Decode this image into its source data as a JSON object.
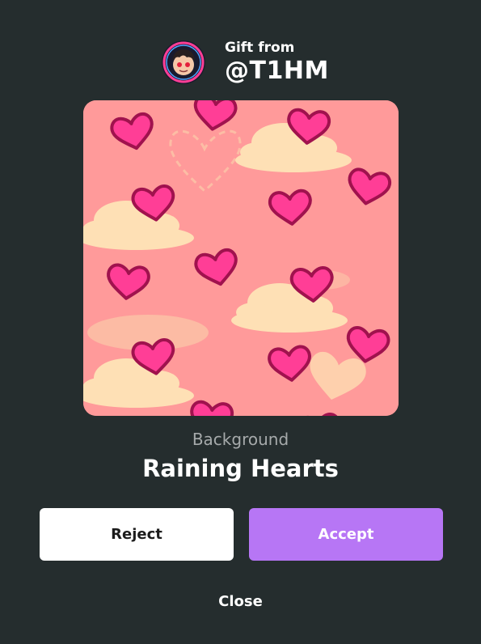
{
  "sender": {
    "gift_from_label": "Gift from",
    "username": "@T1HM"
  },
  "item": {
    "type": "Background",
    "name": "Raining Hearts"
  },
  "actions": {
    "reject_label": "Reject",
    "accept_label": "Accept",
    "close_label": "Close"
  },
  "colors": {
    "background": "#252d2e",
    "accent": "#b776f5",
    "preview_bg": "#ff9a9a",
    "heart_fill": "#ff3e96",
    "heart_stroke": "#a0124e",
    "cloud": "#fee0b5"
  }
}
